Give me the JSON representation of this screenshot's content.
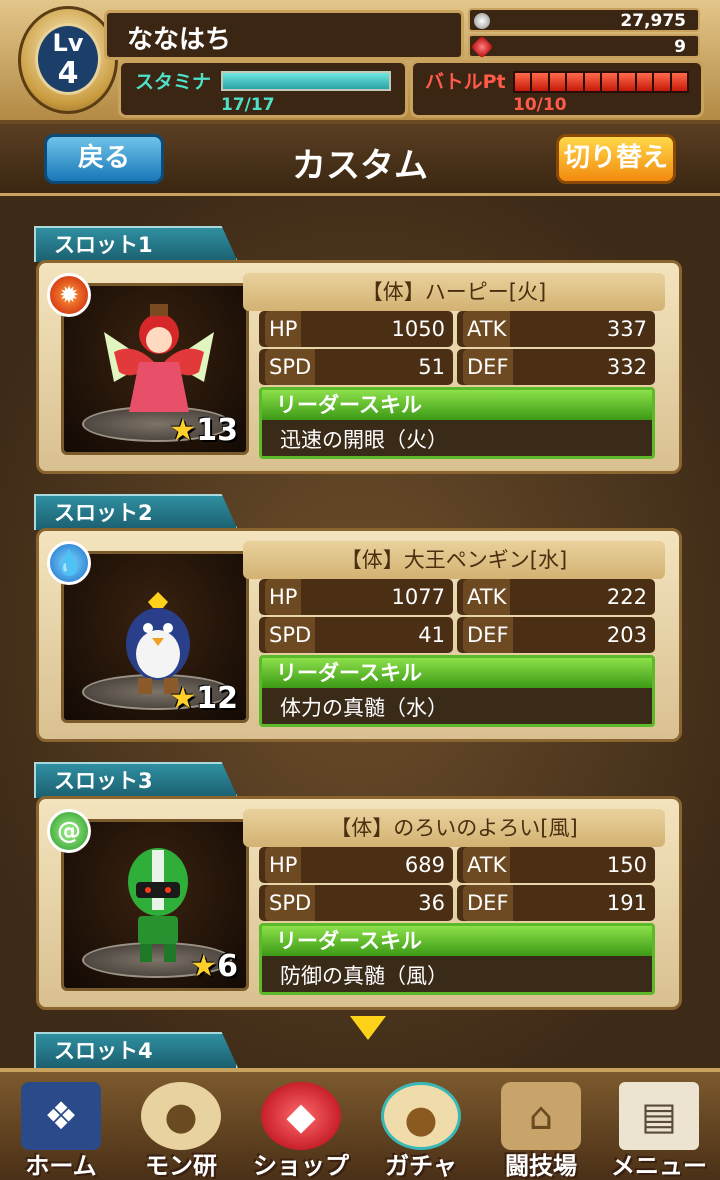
{
  "player": {
    "level_label": "Lv",
    "level": "4",
    "name": "ななはち",
    "coins": "27,975",
    "gems": "9"
  },
  "stamina": {
    "label": "スタミナ",
    "value": "17/17",
    "fraction": 1.0
  },
  "battle_pt": {
    "label": "バトルPt",
    "value": "10/10",
    "segments_filled": 10,
    "segments_total": 10
  },
  "titlebar": {
    "back_label": "戻る",
    "title": "カスタム",
    "switch_label": "切り替え"
  },
  "slots": [
    {
      "tab": "スロット1",
      "element": "fire",
      "element_icon": "fire-icon",
      "name": "【体】ハーピー[火]",
      "hp": "1050",
      "atk": "337",
      "spd": "51",
      "def": "332",
      "stars": "13",
      "leader_title": "リーダースキル",
      "leader_skill": "迅速の開眼（火）"
    },
    {
      "tab": "スロット2",
      "element": "water",
      "element_icon": "water-drop-icon",
      "name": "【体】大王ペンギン[水]",
      "hp": "1077",
      "atk": "222",
      "spd": "41",
      "def": "203",
      "stars": "12",
      "leader_title": "リーダースキル",
      "leader_skill": "体力の真髄（水）"
    },
    {
      "tab": "スロット3",
      "element": "wind",
      "element_icon": "wind-swirl-icon",
      "name": "【体】のろいのよろい[風]",
      "hp": "689",
      "atk": "150",
      "spd": "36",
      "def": "191",
      "stars": "6",
      "leader_title": "リーダースキル",
      "leader_skill": "防御の真髄（風）"
    }
  ],
  "slot4_tab": "スロット4",
  "stat_labels": {
    "hp": "HP",
    "atk": "ATK",
    "spd": "SPD",
    "def": "DEF"
  },
  "nav": [
    {
      "label": "ホーム",
      "icon": "book-icon"
    },
    {
      "label": "モン研",
      "icon": "creature-icon"
    },
    {
      "label": "ショップ",
      "icon": "red-gem-icon"
    },
    {
      "label": "ガチャ",
      "icon": "gacha-creature-icon"
    },
    {
      "label": "闘技場",
      "icon": "colosseum-icon"
    },
    {
      "label": "メニュー",
      "icon": "id-card-icon"
    }
  ],
  "colors": {
    "stamina": "#4fe0c8",
    "battle": "#ff5a4a",
    "slot_tab": "#1b5f70",
    "leader_green": "#5cba2a",
    "switch_orange": "#f28a0e",
    "back_blue": "#1a78b8"
  }
}
